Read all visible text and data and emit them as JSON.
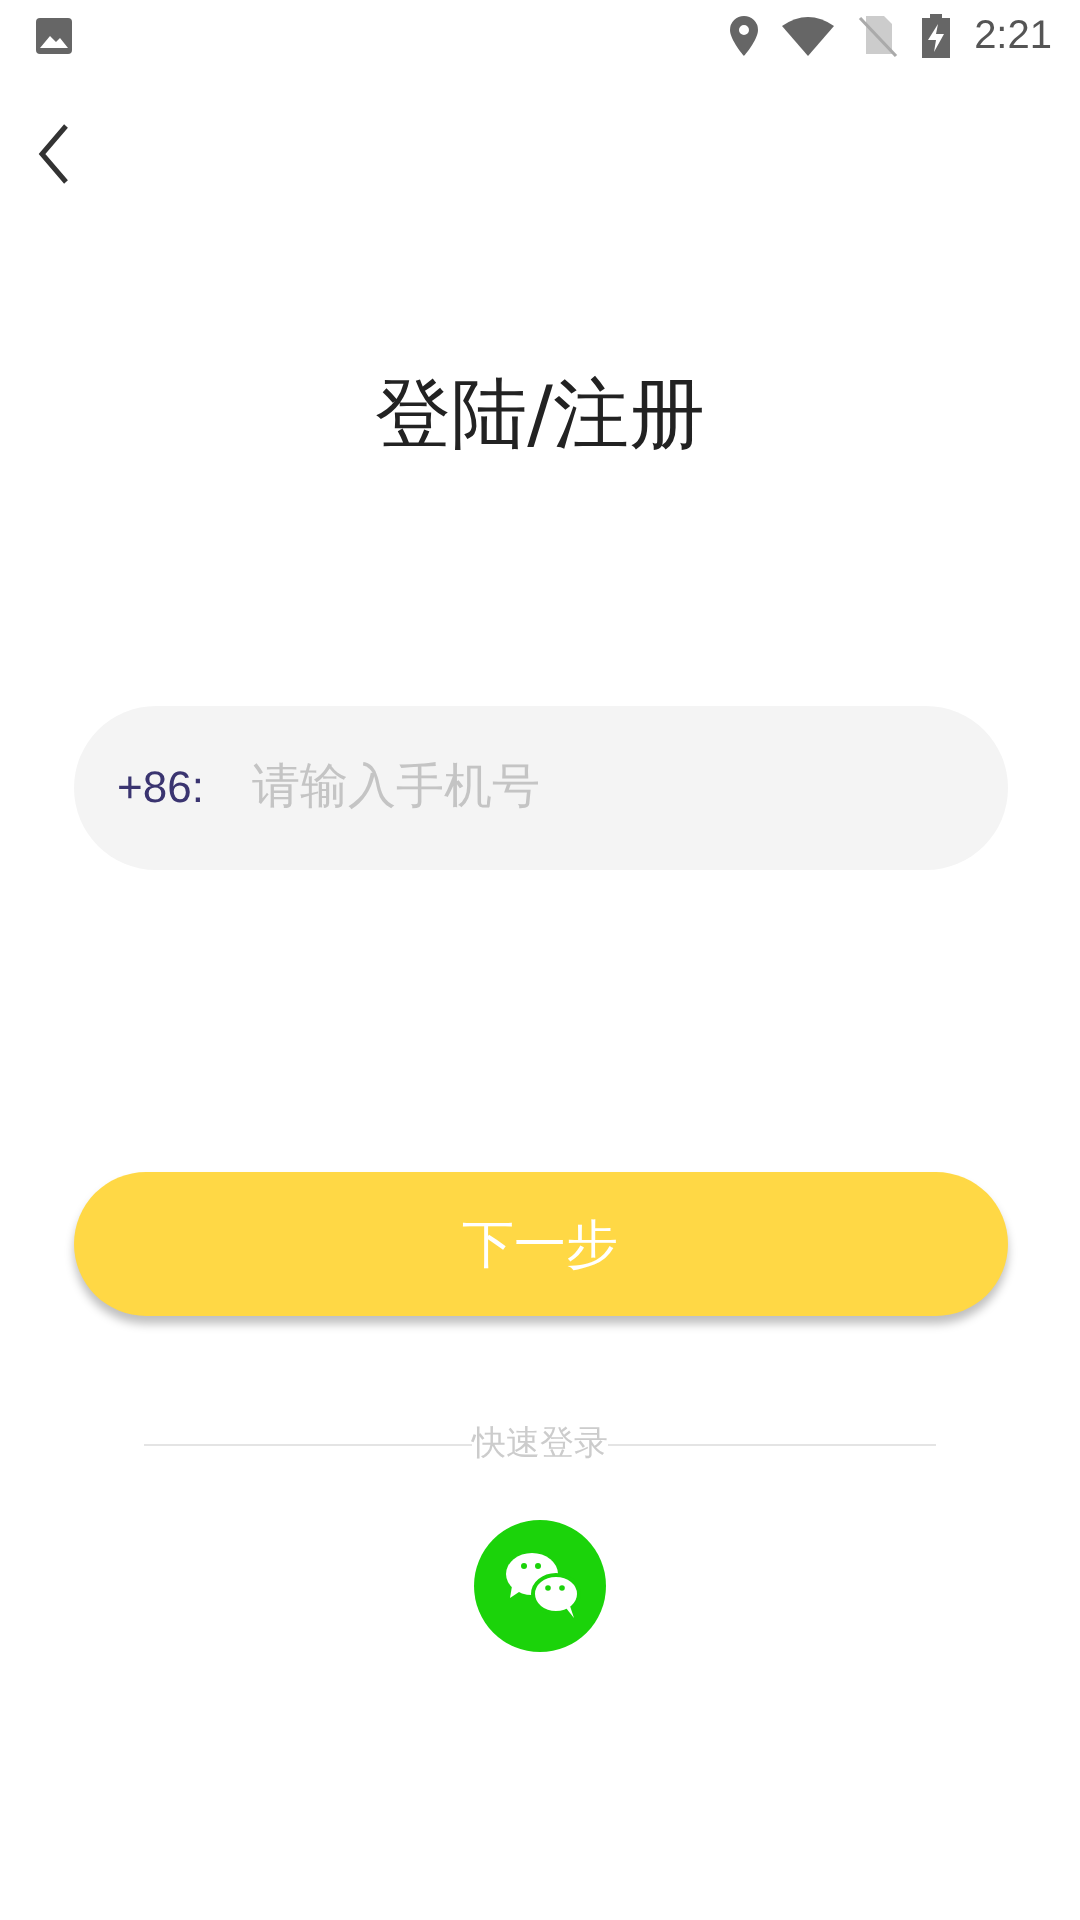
{
  "status_bar": {
    "time": "2:21"
  },
  "title": "登陆/注册",
  "phone_field": {
    "prefix": "+86:",
    "placeholder": "请输入手机号"
  },
  "next_button": {
    "label": "下一步"
  },
  "quick_login": {
    "label": "快速登录"
  }
}
